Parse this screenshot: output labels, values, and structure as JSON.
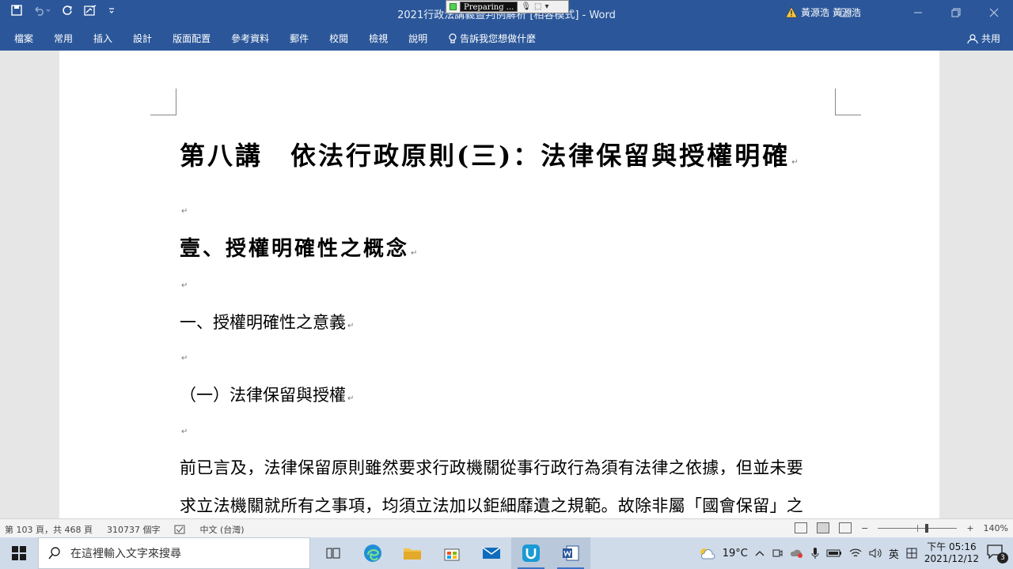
{
  "window": {
    "title": "2021行政法講義暨判例解析 [相容模式]  -  Word",
    "app": "Word",
    "user": "黃源浩 黃源浩"
  },
  "recorder": {
    "label": "Preparing ..."
  },
  "ribbon": {
    "tabs": [
      "檔案",
      "常用",
      "插入",
      "設計",
      "版面配置",
      "參考資料",
      "郵件",
      "校閱",
      "檢視",
      "說明"
    ],
    "tell_me": "告訴我您想做什麼",
    "share": "共用"
  },
  "document": {
    "title": "第八講　依法行政原則(三)：法律保留與授權明確",
    "heading1": "壹、授權明確性之概念",
    "heading2": "一、授權明確性之意義",
    "heading3": "（一）法律保留與授權",
    "body_line1": "前已言及，法律保留原則雖然要求行政機關從事行政行為須有法律之依據，但並未要",
    "body_line2": "求立法機關就所有之事項，均須立法加以鉅細靡遺之規範。故除非屬「國會保留」之",
    "para_mark": "↵"
  },
  "status": {
    "page": "第 103 頁，共 468 頁",
    "words": "310737 個字",
    "language": "中文 (台灣)",
    "zoom": "140%",
    "zoom_minus": "−",
    "zoom_plus": "+"
  },
  "taskbar": {
    "search_placeholder": "在這裡輸入文字來搜尋",
    "weather": "19°C",
    "ime": "英",
    "time": "下午 05:16",
    "date": "2021/12/12",
    "notifications": "3"
  },
  "colors": {
    "word_blue": "#2b579a",
    "taskbar": "#cfdbe9"
  }
}
